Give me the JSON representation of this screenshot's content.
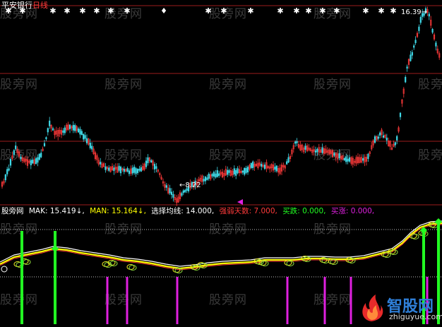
{
  "header": {
    "stock_name": "平安银行",
    "period": "日线"
  },
  "price_labels": {
    "high_label": "16.39",
    "low_label": "8.22"
  },
  "watermark": "股旁网",
  "indicator": {
    "name": "股旁网",
    "mak_label": "MAK: 15.419↓,",
    "man_label": "MAN: 15.164↓,",
    "ma_select_label": "选择均线: 14.000,",
    "strength_days_label": "强弱天数: 7.000,",
    "buy_drop_label": "买跌: 0.000,",
    "buy_rise_label": "买涨: 0.000,"
  },
  "logo": {
    "title": "智股网",
    "url": "zhiguyue.com"
  },
  "colors": {
    "background": "#000000",
    "up": "#ff3a3a",
    "down": "#3fd8e6",
    "grid": "#9b1b1b",
    "star": "#ffffff",
    "mak_line": "#ffffff",
    "man_line": "#ffff00",
    "signal_green": "#22ff22",
    "signal_magenta": "#e020e0",
    "text_white": "#ffffff",
    "text_cyan": "#00ffff"
  }
}
